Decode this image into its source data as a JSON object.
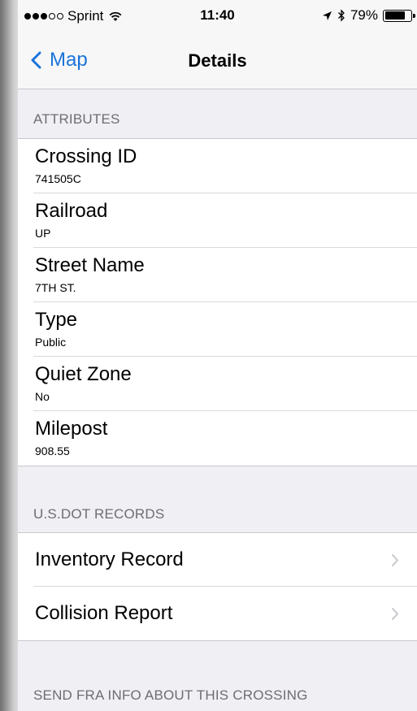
{
  "status_bar": {
    "carrier": "Sprint",
    "signal_bars_filled": 3,
    "signal_bars_total": 5,
    "time": "11:40",
    "battery_percent": "79%",
    "battery_level": 0.79,
    "icons": [
      "wifi-icon",
      "location-arrow-icon",
      "bluetooth-icon",
      "battery-icon"
    ]
  },
  "nav": {
    "back_label": "Map",
    "title": "Details"
  },
  "attributes": {
    "header": "ATTRIBUTES",
    "items": [
      {
        "label": "Crossing ID",
        "value": "741505C"
      },
      {
        "label": "Railroad",
        "value": "UP"
      },
      {
        "label": "Street Name",
        "value": "7TH ST."
      },
      {
        "label": "Type",
        "value": "Public"
      },
      {
        "label": "Quiet Zone",
        "value": "No"
      },
      {
        "label": "Milepost",
        "value": "908.55"
      }
    ]
  },
  "records": {
    "header": "U.S.DOT RECORDS",
    "items": [
      {
        "label": "Inventory Record"
      },
      {
        "label": "Collision Report"
      }
    ]
  },
  "send_info": {
    "header": "SEND FRA INFO ABOUT THIS CROSSING"
  },
  "colors": {
    "accent": "#1a73d9",
    "background": "#efeff4",
    "section_text": "#6d6d72",
    "chevron": "#c7c7cc"
  }
}
